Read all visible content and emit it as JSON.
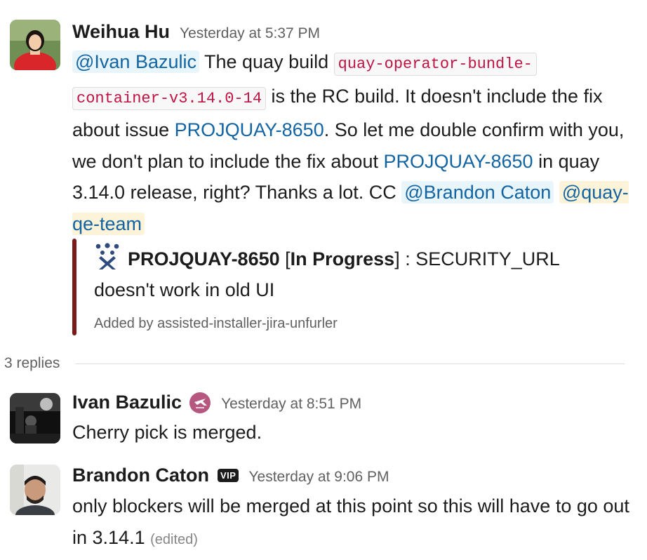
{
  "messages": [
    {
      "author": "Weihua Hu",
      "time": "Yesterday at 5:37 PM",
      "mention_ivan": "@Ivan Bazulic",
      "text_1": " The quay build ",
      "code_1": "quay-operator-bundle-",
      "code_2": "container-v3.14.0-14",
      "text_2": " is the RC build. It doesn't include the fix about issue ",
      "link_1": "PROJQUAY-8650",
      "text_3": ". So let me double confirm with you,  we don't plan to include the fix about ",
      "link_2": "PROJQUAY-8650",
      "text_4": " in quay 3.14.0 release, right? Thanks a lot. CC ",
      "mention_brandon": "@Brandon Caton",
      "mention_team": "@quay-qe-team"
    },
    {
      "author": "Ivan Bazulic",
      "time": "Yesterday at 8:51 PM",
      "text": "Cherry pick is merged.",
      "status_emoji": "airplane-badge-icon"
    },
    {
      "author": "Brandon Caton",
      "badge": "VIP",
      "time": "Yesterday at 9:06 PM",
      "text": "only blockers will be merged at this point so this will have to go out in 3.14.1",
      "edited": "(edited)"
    }
  ],
  "unfurl": {
    "issue_key": "PROJQUAY-8650",
    "status_open": " [",
    "status": "In Progress",
    "status_close": "] : SECURITY_URL doesn't work in old UI",
    "footer": "Added by assisted-installer-jira-unfurler",
    "icon": "jira-icon",
    "bar_color": "#7a1b1b"
  },
  "thread": {
    "replies_label": "3 replies"
  },
  "colors": {
    "link": "#1264a3",
    "mention_bg": "#e8f5fa",
    "team_mention_bg": "#fdf3d8",
    "code_text": "#c01343",
    "muted": "#616061"
  }
}
